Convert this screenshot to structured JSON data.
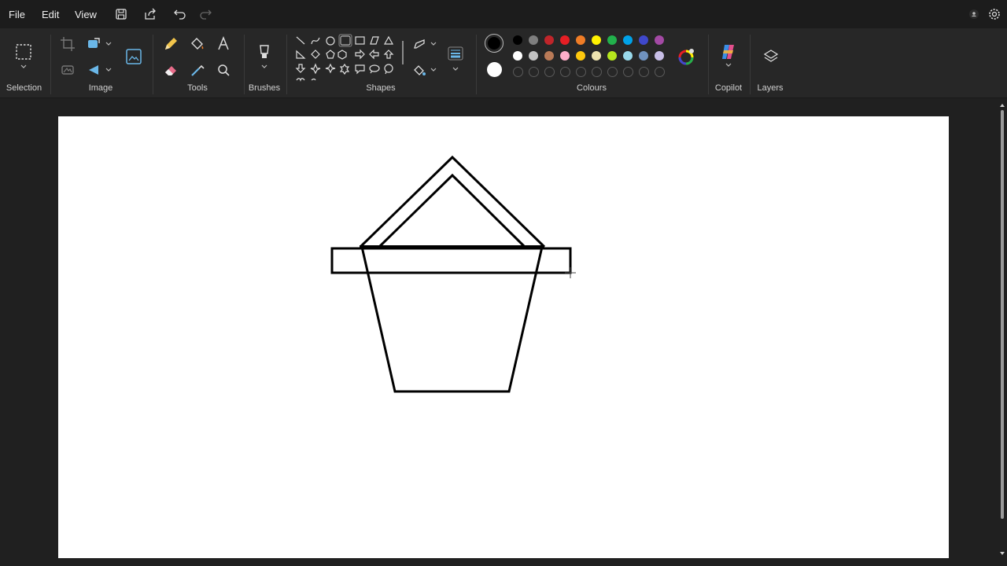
{
  "menu": {
    "file": "File",
    "edit": "Edit",
    "view": "View"
  },
  "ribbon": {
    "groups": {
      "selection": "Selection",
      "image": "Image",
      "tools": "Tools",
      "brushes": "Brushes",
      "shapes": "Shapes",
      "colours": "Colours",
      "copilot": "Copilot",
      "layers": "Layers"
    }
  },
  "colors": {
    "primary": "#000000",
    "secondary": "#ffffff",
    "palette_row1": [
      "#000000",
      "#7f7f7f",
      "#c0252a",
      "#e61e24",
      "#f07d26",
      "#fff200",
      "#22b14c",
      "#00a2e8",
      "#3f48cc",
      "#a349a4"
    ],
    "palette_row2": [
      "#ffffff",
      "#c3c3c3",
      "#b97a57",
      "#ffaec9",
      "#ffc90e",
      "#efe4b0",
      "#b5e61d",
      "#99d9ea",
      "#7092be",
      "#c8bfe7"
    ]
  }
}
